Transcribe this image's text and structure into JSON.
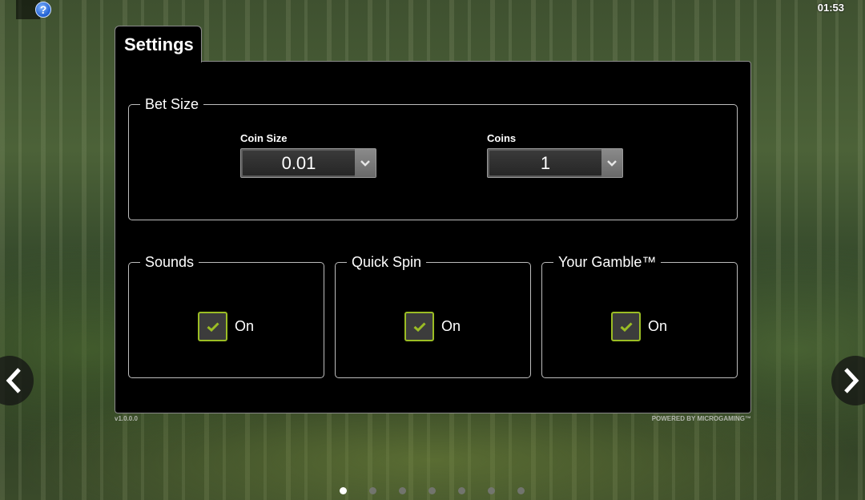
{
  "header": {
    "help_label": "?",
    "clock": "01:53"
  },
  "settings": {
    "tab_title": "Settings",
    "bet_size": {
      "title": "Bet Size",
      "coin_size": {
        "label": "Coin Size",
        "value": "0.01"
      },
      "coins": {
        "label": "Coins",
        "value": "1"
      }
    },
    "sounds": {
      "title": "Sounds",
      "label": "On",
      "checked": true
    },
    "quick_spin": {
      "title": "Quick Spin",
      "label": "On",
      "checked": true
    },
    "gamble": {
      "title": "Your Gamble™",
      "label": "On",
      "checked": true
    }
  },
  "footer": {
    "version": "v1.0.0.0",
    "powered": "POWERED BY MICROGAMING™"
  },
  "pagination": {
    "count": 7,
    "active": 0
  },
  "colors": {
    "check_accent": "#9bbd24",
    "panel_bg": "#000000"
  },
  "icons": {
    "help": "question-icon",
    "check": "checkmark-icon",
    "dropdown": "chevron-down-icon",
    "prev": "chevron-left-icon",
    "next": "chevron-right-icon"
  }
}
